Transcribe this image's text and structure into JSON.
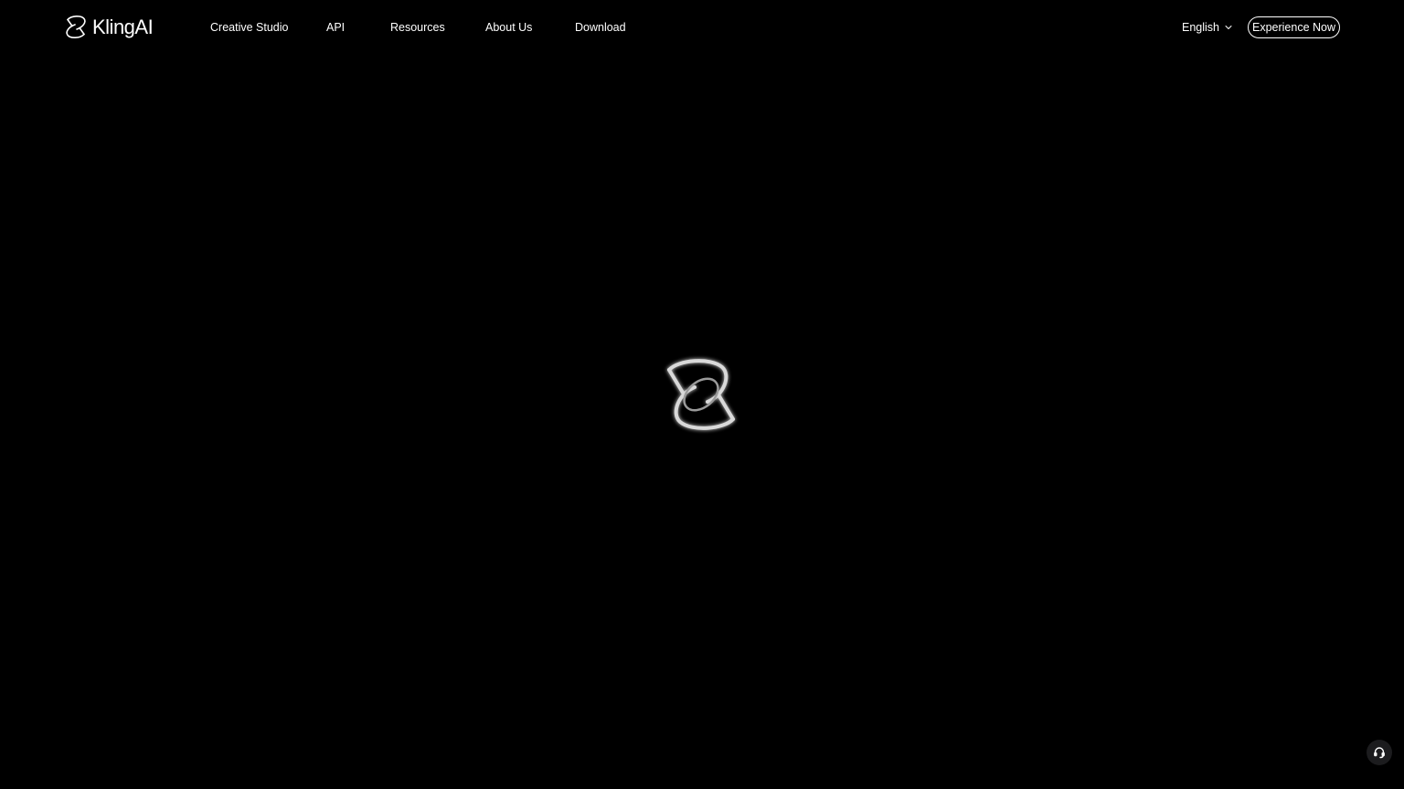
{
  "brand": {
    "name": "KlingAI",
    "logo_icon": "kling-logo-icon"
  },
  "nav": {
    "items": [
      {
        "label": "Creative Studio"
      },
      {
        "label": "API"
      },
      {
        "label": "Resources"
      },
      {
        "label": "About Us"
      },
      {
        "label": "Download"
      }
    ]
  },
  "language": {
    "selected": "English",
    "icon": "chevron-down-icon"
  },
  "cta": {
    "label": "Experience Now"
  },
  "loader": {
    "icon": "kling-logo-loading-icon"
  },
  "support": {
    "icon": "headset-icon"
  },
  "colors": {
    "background": "#000000",
    "text": "#ffffff",
    "support_bg": "#1c1c1e"
  }
}
